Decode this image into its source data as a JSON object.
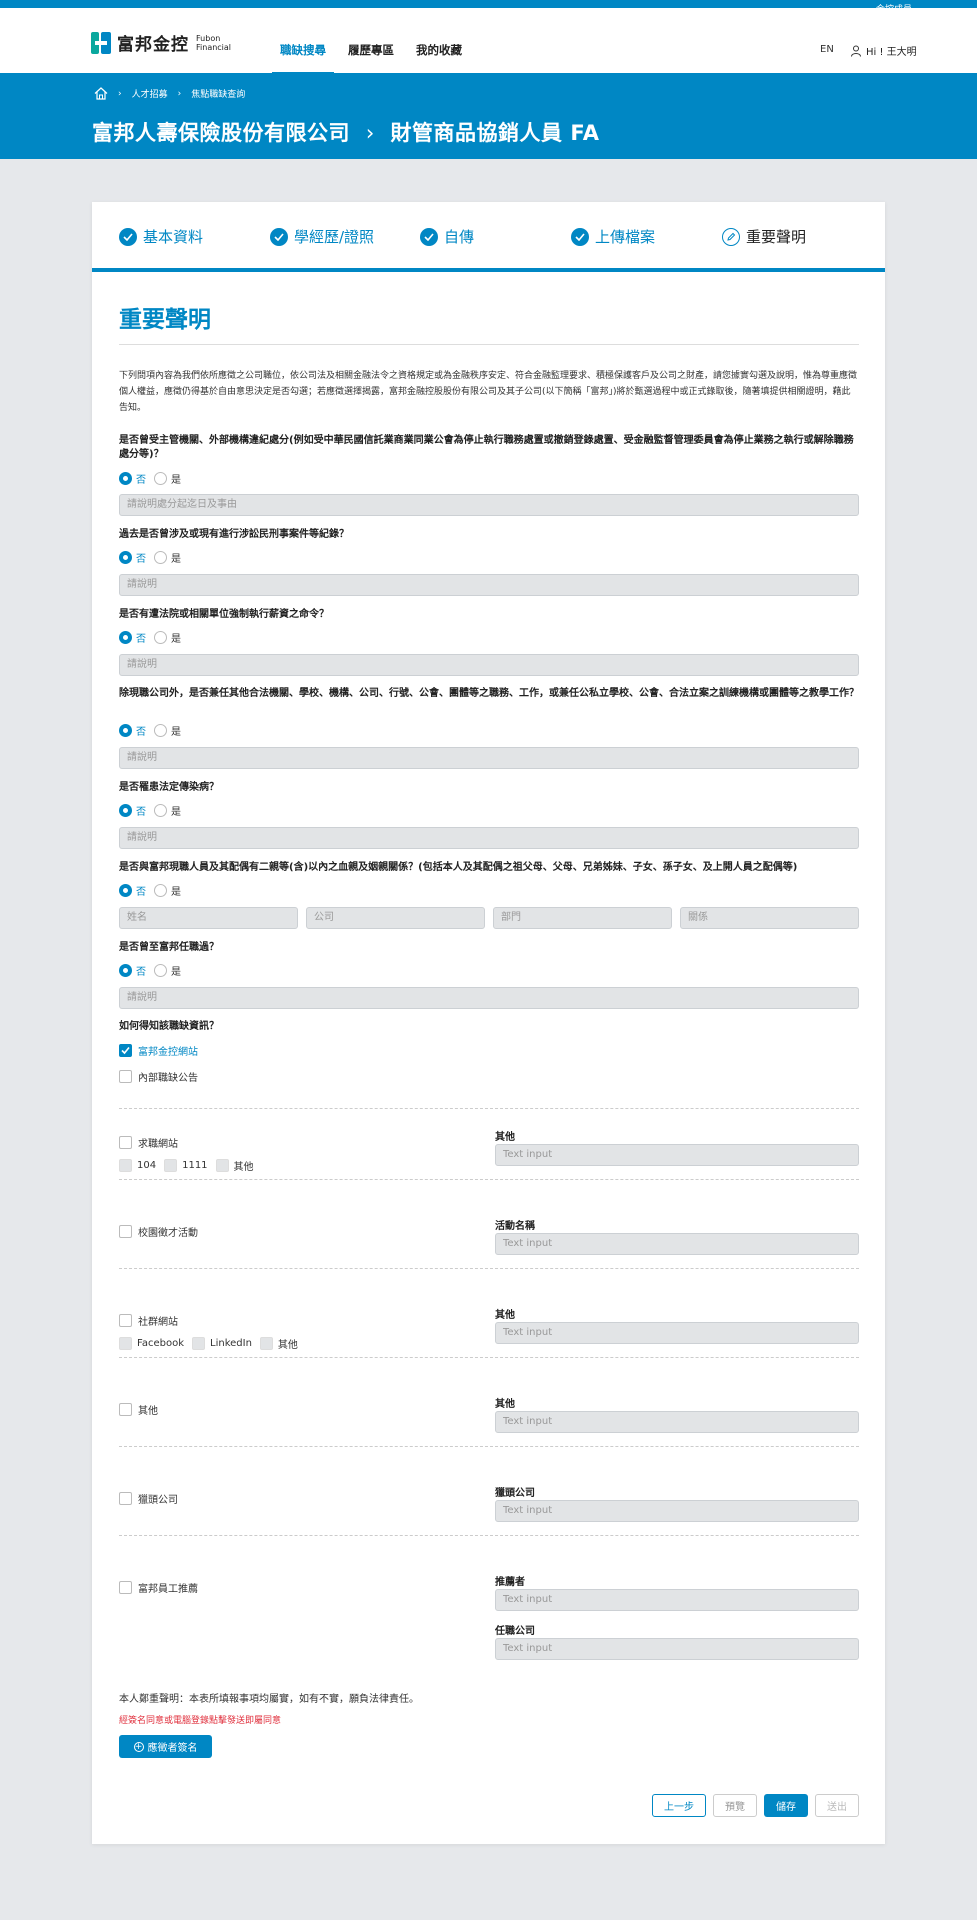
{
  "header": {
    "group_link": "金控成員",
    "logo_cn": "富邦金控",
    "logo_en_1": "Fubon",
    "logo_en_2": "Financial",
    "nav": [
      "職缺搜尋",
      "履歷專區",
      "我的收藏"
    ],
    "lang": "EN",
    "user": "Hi ! 王大明"
  },
  "hero": {
    "breadcrumb": [
      "人才招募",
      "焦點職缺查詢"
    ],
    "company": "富邦人壽保險股份有限公司",
    "arrow": "›",
    "position": "財管商品協銷人員 FA"
  },
  "steps": [
    "基本資料",
    "學經歷/證照",
    "自傳",
    "上傳檔案",
    "重要聲明"
  ],
  "form": {
    "title": "重要聲明",
    "intro": "下列問項內容為我們依所應徵之公司職位，依公司法及相關金融法令之資格規定或為金融秩序安定、符合金融監理要求、積極保護客戶及公司之財產，請您據實勾選及說明，惟為尊重應徵個人權益，應徵仍得基於自由意思決定是否勾選；若應徵選擇揭露，富邦金融控股股份有限公司及其子公司(以下簡稱「富邦」)將於甄選過程中或正式錄取後，隨著填提供相關證明，藉此告知。",
    "radio_no": "否",
    "radio_yes": "是",
    "questions": [
      {
        "q": "是否曾受主管機關、外部機構違紀處分(例如受中華民國信託業商業同業公會為停止執行職務處置或撤銷登錄處置、受金融監督管理委員會為停止業務之執行或解除職務處分等)？",
        "placeholder": "請說明處分起迄日及事由"
      },
      {
        "q": "過去是否曾涉及或現有進行涉訟民刑事案件等紀錄？",
        "placeholder": "請說明"
      },
      {
        "q": "是否有遭法院或相關單位強制執行薪資之命令？",
        "placeholder": "請說明"
      },
      {
        "q": "除現職公司外，是否兼任其他合法機關、學校、機構、公司、行號、公會、團體等之職務、工作，或兼任公私立學校、公會、合法立案之訓練機構或團體等之教學工作？",
        "placeholder": "請說明"
      },
      {
        "q": "是否罹患法定傳染病？",
        "placeholder": "請說明"
      },
      {
        "q": "是否與富邦現職人員及其配偶有二親等(含)以內之血親及姻親關係？(包括本人及其配偶之祖父母、父母、兄弟姊妹、子女、孫子女、及上開人員之配偶等)",
        "placeholders": [
          "姓名",
          "公司",
          "部門",
          "關係"
        ]
      },
      {
        "q": "是否曾至富邦任職過？",
        "placeholder": "請說明"
      }
    ],
    "source_q": "如何得知該職缺資訊？",
    "source_options": [
      "富邦金控網站",
      "內部職缺公告"
    ],
    "source_groups": [
      {
        "label": "求職網站",
        "subs": [
          "104",
          "1111",
          "其他"
        ],
        "field_label": "其他",
        "placeholder": "Text input"
      },
      {
        "label": "校園徵才活動",
        "field_label": "活動名稱",
        "placeholder": "Text input"
      },
      {
        "label": "社群網站",
        "subs": [
          "Facebook",
          "LinkedIn",
          "其他"
        ],
        "field_label": "其他",
        "placeholder": "Text input"
      },
      {
        "label": "其他",
        "field_label": "其他",
        "placeholder": "Text input"
      },
      {
        "label": "獵頭公司",
        "field_label": "獵頭公司",
        "placeholder": "Text input"
      },
      {
        "label": "富邦員工推薦",
        "field_label": "推薦者",
        "placeholder": "Text input",
        "field_label2": "任職公司",
        "placeholder2": "Text input"
      }
    ],
    "declaration": "本人鄭重聲明：本表所填報事項均屬實，如有不實，願負法律責任。",
    "sign_note": "經簽名同意或電腦登錄點擊發送即屬同意",
    "sign_button": "應徵者簽名",
    "buttons": {
      "prev": "上一步",
      "preview": "預覽",
      "save": "儲存",
      "submit": "送出"
    }
  },
  "colors": {
    "primary": "#0087c4",
    "background": "#e6e8eb",
    "alert": "#e0303d"
  }
}
